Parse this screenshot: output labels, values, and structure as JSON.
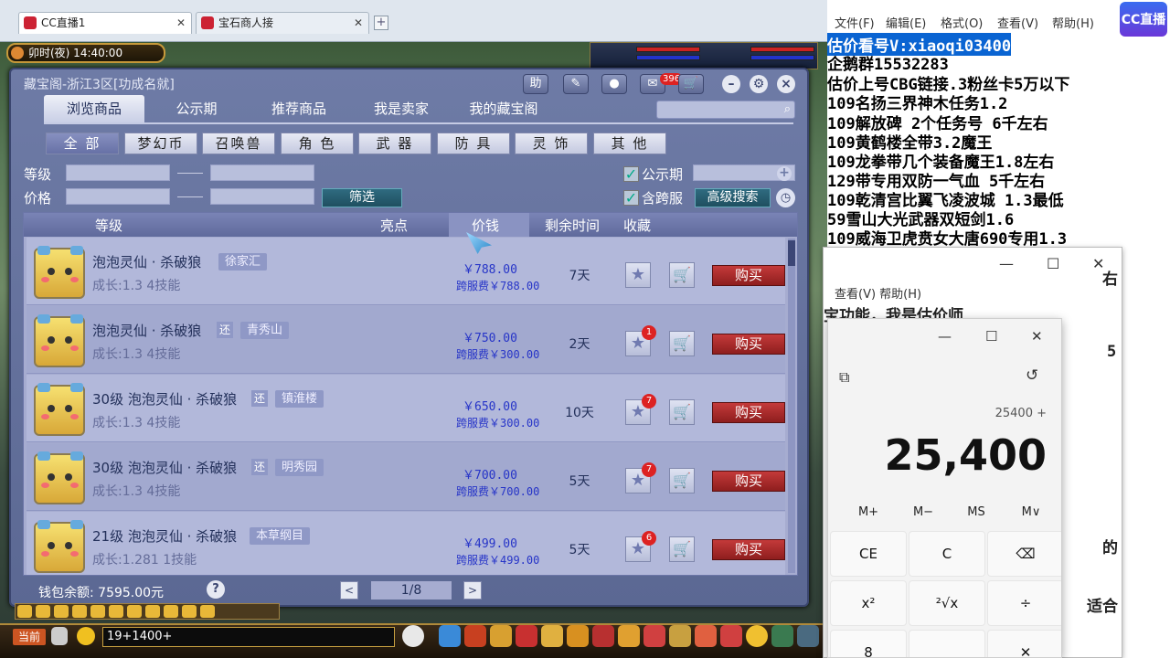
{
  "browser": {
    "tabs": [
      {
        "label": "CC直播1",
        "close": "✕"
      },
      {
        "label": "宝石商人接",
        "close": "✕"
      }
    ],
    "new_tab": "+"
  },
  "game": {
    "clock": "卯时(夜)  14:40:00",
    "dialog": {
      "title": "藏宝阁-浙江3区[功成名就]",
      "header_buttons": {
        "help": "助",
        "mail_badge": "396"
      },
      "nav_tabs": [
        {
          "label": "浏览商品",
          "active": true
        },
        {
          "label": "公示期"
        },
        {
          "label": "推荐商品"
        },
        {
          "label": "我是卖家"
        },
        {
          "label": "我的藏宝阁"
        }
      ],
      "categories": [
        {
          "label": "全 部",
          "active": true
        },
        {
          "label": "梦幻币"
        },
        {
          "label": "召唤兽"
        },
        {
          "label": "角 色"
        },
        {
          "label": "武 器"
        },
        {
          "label": "防 具"
        },
        {
          "label": "灵 饰"
        },
        {
          "label": "其 他"
        }
      ],
      "filters": {
        "level_label": "等级",
        "price_label": "价格",
        "filter_button": "筛选",
        "public_label": "公示期",
        "cross_label": "含跨服",
        "advanced_button": "高级搜索"
      },
      "table_headers": {
        "level": "等级",
        "highlight": "亮点",
        "price": "价钱",
        "remaining": "剩余时间",
        "favorite": "收藏"
      },
      "items": [
        {
          "name": "泡泡灵仙 · 杀破狼",
          "huan": "",
          "server": "徐家汇",
          "growth": "成长:1.3  4技能",
          "price": "￥788.00",
          "cross_price": "跨服费￥788.00",
          "days": "7天",
          "fav_badge": "",
          "buy": "购买"
        },
        {
          "name": "泡泡灵仙 · 杀破狼",
          "huan": "还",
          "server": "青秀山",
          "growth": "成长:1.3  4技能",
          "price": "￥750.00",
          "cross_price": "跨服费￥300.00",
          "days": "2天",
          "fav_badge": "1",
          "buy": "购买"
        },
        {
          "name": "30级  泡泡灵仙 · 杀破狼",
          "huan": "还",
          "server": "镇淮楼",
          "growth": "成长:1.3  4技能",
          "price": "￥650.00",
          "cross_price": "跨服费￥300.00",
          "days": "10天",
          "fav_badge": "7",
          "buy": "购买"
        },
        {
          "name": "30级  泡泡灵仙 · 杀破狼",
          "huan": "还",
          "server": "明秀园",
          "growth": "成长:1.3  4技能",
          "price": "￥700.00",
          "cross_price": "跨服费￥700.00",
          "days": "5天",
          "fav_badge": "7",
          "buy": "购买"
        },
        {
          "name": "21级  泡泡灵仙 · 杀破狼",
          "huan": "",
          "server": "本草纲目",
          "growth": "成长:1.281  1技能",
          "price": "￥499.00",
          "cross_price": "跨服费￥499.00",
          "days": "5天",
          "fav_badge": "6",
          "buy": "购买"
        }
      ],
      "wallet": "钱包余额: 7595.00元",
      "help_q": "?",
      "pagination": {
        "prev": "<",
        "page": "1/8",
        "next": ">"
      }
    },
    "bottom": {
      "current": "当前",
      "chat_value": "19+1400+"
    }
  },
  "notepad": {
    "menu": [
      "文件(F)",
      "编辑(E)",
      "格式(O)",
      "查看(V)",
      "帮助(H)"
    ],
    "logo": "CC直播",
    "lines": [
      "估价看号V:xiaoqi03400",
      "企鹅群15532283",
      "估价上号CBG链接.3粉丝卡5万以下",
      "109名扬三界神木任务1.2",
      "109解放碑 2个任务号 6千左右",
      "109黄鹤楼全带3.2魔王",
      "109龙拳带几个装备魔王1.8左右",
      "129带专用双防一气血 5千左右",
      "109乾清宫比翼飞凌波城 1.3最低",
      "59雪山大光武器双短剑1.6",
      "109威海卫虎贲女大唐690专用1.3"
    ]
  },
  "notepad2": {
    "controls": [
      "—",
      "☐",
      "✕"
    ],
    "menu": "查看(V)    帮助(H)",
    "text": "宝功能，我是估价师",
    "fragments": [
      "右",
      "5",
      "的",
      "适合"
    ]
  },
  "calculator": {
    "controls": [
      "—",
      "☐",
      "✕"
    ],
    "keep_on_top": "⧉",
    "history": "↺",
    "expression": "25400 +",
    "display": "25,400",
    "memory": [
      "M+",
      "M−",
      "MS",
      "M∨"
    ],
    "keys": [
      "CE",
      "C",
      "⌫",
      "x²",
      "²√x",
      "÷",
      "8",
      "✕"
    ]
  }
}
